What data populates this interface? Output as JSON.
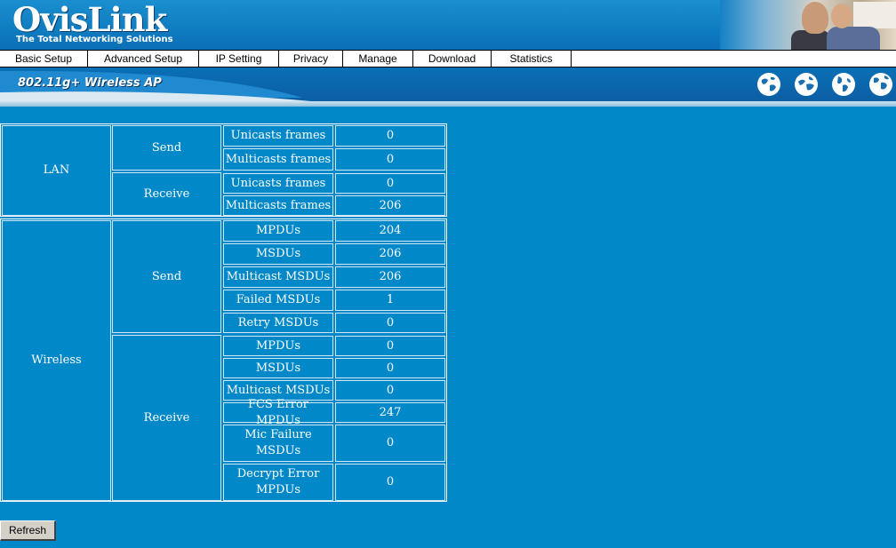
{
  "header": {
    "logo": "OvisLink",
    "tagline": "The Total Networking Solutions"
  },
  "menu": {
    "items": [
      {
        "label": "Basic Setup"
      },
      {
        "label": "Advanced Setup"
      },
      {
        "label": "IP Setting"
      },
      {
        "label": "Privacy"
      },
      {
        "label": "Manage"
      },
      {
        "label": "Download"
      },
      {
        "label": "Statistics"
      }
    ]
  },
  "banner": {
    "title": "802.11g+ Wireless AP",
    "icons": [
      "globe-icon",
      "globe-icon",
      "globe-icon",
      "globe-icon"
    ]
  },
  "stats": {
    "lan": {
      "label": "LAN",
      "send": {
        "label": "Send",
        "rows": [
          {
            "name": "Unicasts frames",
            "value": "0"
          },
          {
            "name": "Multicasts frames",
            "value": "0"
          }
        ]
      },
      "receive": {
        "label": "Receive",
        "rows": [
          {
            "name": "Unicasts frames",
            "value": "0"
          },
          {
            "name": "Multicasts frames",
            "value": "206"
          }
        ]
      }
    },
    "wireless": {
      "label": "Wireless",
      "send": {
        "label": "Send",
        "rows": [
          {
            "name": "MPDUs",
            "value": "204"
          },
          {
            "name": "MSDUs",
            "value": "206"
          },
          {
            "name": "Multicast MSDUs",
            "value": "206"
          },
          {
            "name": "Failed MSDUs",
            "value": "1"
          },
          {
            "name": "Retry MSDUs",
            "value": "0"
          }
        ]
      },
      "receive": {
        "label": "Receive",
        "rows": [
          {
            "name": "MPDUs",
            "value": "0"
          },
          {
            "name": "MSDUs",
            "value": "0"
          },
          {
            "name": "Multicast MSDUs",
            "value": "0"
          },
          {
            "name": "FCS Error MPDUs",
            "value": "247"
          },
          {
            "name": "Mic Failure MSDUs",
            "value": "0"
          },
          {
            "name": "Decrypt Error MPDUs",
            "value": "0"
          }
        ]
      }
    }
  },
  "refresh_label": "Refresh",
  "colors": {
    "page_bg": "#0088c8",
    "header_bg": "#0a6fb6",
    "text": "#ffffff"
  }
}
